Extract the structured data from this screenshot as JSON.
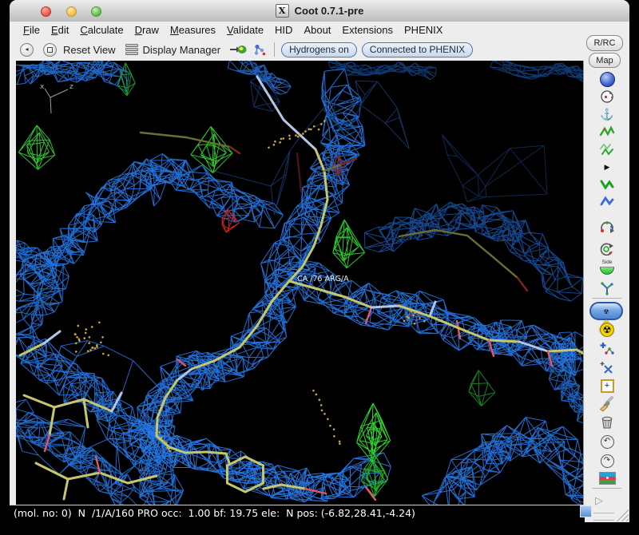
{
  "window": {
    "title": "Coot 0.7.1-pre"
  },
  "menubar": {
    "items": [
      {
        "label": "File"
      },
      {
        "label": "Edit"
      },
      {
        "label": "Calculate"
      },
      {
        "label": "Draw"
      },
      {
        "label": "Measures"
      },
      {
        "label": "Validate"
      },
      {
        "label": "HID"
      },
      {
        "label": "About"
      },
      {
        "label": "Extensions"
      },
      {
        "label": "PHENIX"
      }
    ]
  },
  "toolbar": {
    "reset_view_label": "Reset View",
    "display_manager_label": "Display Manager",
    "hydrogens_label": "Hydrogens on",
    "phenix_label": "Connected to PHENIX"
  },
  "side_buttons": {
    "rrc_label": "R/RC",
    "map_label": "Map"
  },
  "right_toolbar": {
    "side_flip_label": "Side",
    "icons": [
      "sphere-refine-icon",
      "environment-distances-icon",
      "fix-atoms-anchor-icon",
      "real-space-refine-icon",
      "regularize-zone-icon",
      "flip-peptide-icon",
      "rigid-body-fit-icon",
      "rotate-translate-zone-icon",
      "auto-fit-rotamer-icon",
      "edit-chi-angles-icon",
      "side-chain-flip-icon",
      "rotamers-icon",
      "mutate-autofit-button",
      "simple-mutate-icon",
      "add-terminal-residue-icon",
      "add-alt-conf-icon",
      "place-atom-icon",
      "clear-pending-picks-icon",
      "delete-item-icon",
      "undo-icon",
      "redo-icon",
      "run-refmac-flag-icon",
      "more-tools-icon"
    ]
  },
  "canvas": {
    "atom_label": "CA /76 ARG/A",
    "axis_labels": {
      "x": "x",
      "z": "z"
    }
  },
  "statusbar": {
    "text": "(mol. no: 0)  N  /1/A/160 PRO occ:  1.00 bf: 19.75 ele:  N pos: (-6.82,28.41,-4.24)"
  },
  "colors": {
    "density_2fofc": "#2579e8",
    "density_2fofc_dim": "#16509e",
    "density_fofc_positive": "#2ecc2e",
    "density_fofc_negative": "#d42222",
    "model_carbon": "#c6c66e",
    "model_nitrogen": "#b4c6e8",
    "model_oxygen": "#e25868",
    "selection_accent": "#2a5aa8"
  }
}
